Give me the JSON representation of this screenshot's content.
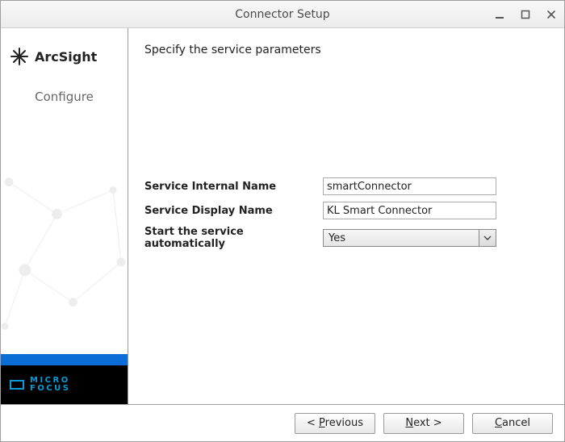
{
  "window": {
    "title": "Connector Setup"
  },
  "sidebar": {
    "brand": "ArcSight",
    "step": "Configure",
    "footer_brand_line1": "MICRO",
    "footer_brand_line2": "FOCUS"
  },
  "content": {
    "heading": "Specify the service parameters",
    "fields": {
      "internal_name_label": "Service Internal Name",
      "internal_name_value": "smartConnector",
      "display_name_label": "Service Display Name",
      "display_name_value": "KL Smart Connector",
      "autostart_label": "Start the service automatically",
      "autostart_value": "Yes"
    }
  },
  "buttons": {
    "previous_prefix": "< ",
    "previous_mn": "P",
    "previous_suffix": "revious",
    "next_mn": "N",
    "next_suffix": "ext >",
    "cancel_mn": "C",
    "cancel_suffix": "ancel"
  }
}
